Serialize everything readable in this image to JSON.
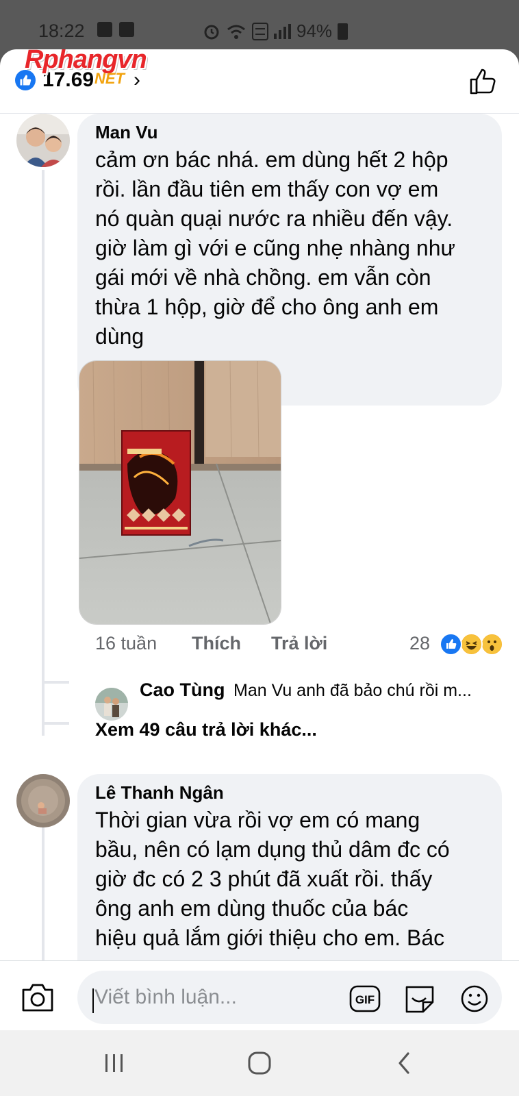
{
  "status_bar": {
    "time": "18:22",
    "battery": "94%"
  },
  "watermark": {
    "brand": "Rphangvn",
    "suffix": "NET"
  },
  "header": {
    "like_count": "17.69",
    "chevron": "›",
    "icons": [
      "like-reaction-icon",
      "thumbs-up-icon"
    ]
  },
  "comments": [
    {
      "author": "Man Vu",
      "lines": [
        "cảm ơn bác nhá. em dùng hết 2 hộp",
        "rồi. lần đầu tiên em thấy con vợ em",
        "nó quàn quại nước ra nhiều đến vậy.",
        "giờ làm gì với e cũng nhẹ nhàng như",
        "gái mới về nhà chồng. em vẫn còn",
        "thừa 1 hộp, giờ để cho ông anh em",
        "dùng"
      ],
      "time": "16 tuần",
      "like_label": "Thích",
      "reply_label": "Trả lời",
      "reaction_count": "28",
      "reactions": [
        "like",
        "haha",
        "wow"
      ],
      "reply_preview": {
        "author": "Cao Tùng",
        "text": "Man Vu anh đã bảo chú rồi m..."
      },
      "more_replies": "Xem 49 câu trả lời khác..."
    },
    {
      "author": "Lê Thanh Ngân",
      "lines": [
        "Thời gian vừa rồi vợ em có mang",
        "bầu, nên có lạm dụng thủ dâm đc có",
        "giờ đc có 2 3 phút đã xuất rồi. thấy",
        "ông anh em dùng thuốc của bác",
        "hiệu quả lắm giới thiệu cho em. Bác"
      ]
    }
  ],
  "composer": {
    "placeholder": "Viết bình luận...",
    "gif_label": "GIF",
    "icons": [
      "camera-icon",
      "gif-icon",
      "sticker-icon",
      "emoji-icon"
    ]
  },
  "colors": {
    "accent": "#1877f2",
    "bubble": "#f0f2f5",
    "secondary_text": "#65676b",
    "watermark_red": "#e8262a",
    "watermark_orange": "#f2a30f"
  },
  "nav": {
    "icons": [
      "recent-apps-icon",
      "home-icon",
      "back-icon"
    ]
  }
}
